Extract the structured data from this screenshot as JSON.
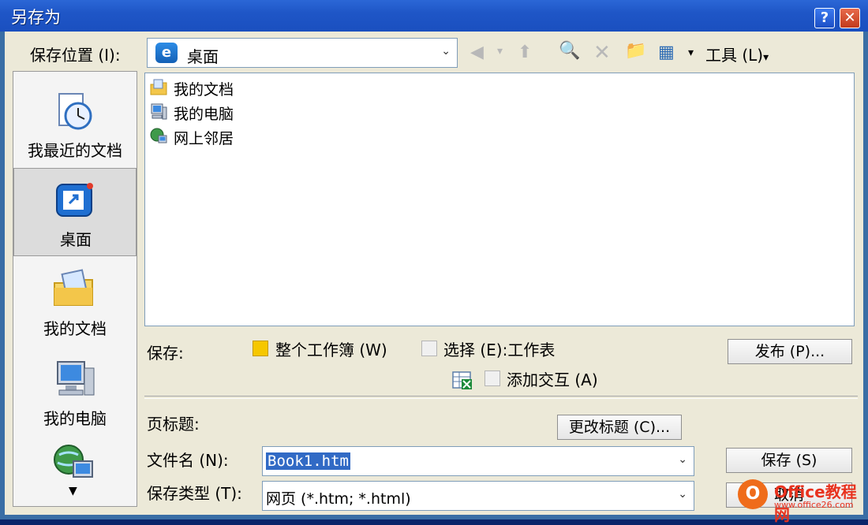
{
  "window": {
    "title": "另存为"
  },
  "titlebar": {
    "help_label": "?",
    "close_label": "✕"
  },
  "location": {
    "label": "保存位置 (I):",
    "value": "桌面"
  },
  "toolbar": {
    "tools_label": "工具 (L)"
  },
  "places": [
    {
      "label": "我最近的文档",
      "icon": "recent-documents-icon"
    },
    {
      "label": "桌面",
      "icon": "desktop-icon",
      "active": true
    },
    {
      "label": "我的文档",
      "icon": "my-documents-icon"
    },
    {
      "label": "我的电脑",
      "icon": "my-computer-icon"
    },
    {
      "label": "",
      "icon": "network-places-icon"
    }
  ],
  "files": [
    {
      "name": "我的文档",
      "icon": "my-documents-icon"
    },
    {
      "name": "我的电脑",
      "icon": "my-computer-icon"
    },
    {
      "name": "网上邻居",
      "icon": "network-icon"
    }
  ],
  "save_options": {
    "label": "保存:",
    "whole_workbook": "整个工作簿 (W)",
    "selection": "选择 (E):工作表",
    "add_interactive": "添加交互 (A)",
    "publish_button": "发布 (P)..."
  },
  "page_title": {
    "label": "页标题:",
    "change_button": "更改标题 (C)..."
  },
  "filename": {
    "label": "文件名 (N):",
    "value": "Book1.htm"
  },
  "filetype": {
    "label": "保存类型 (T):",
    "value": "网页 (*.htm; *.html)"
  },
  "buttons": {
    "save": "保存 (S)",
    "cancel": "取消"
  },
  "watermark": {
    "title": "Office教程网",
    "url": "www.office26.com"
  }
}
